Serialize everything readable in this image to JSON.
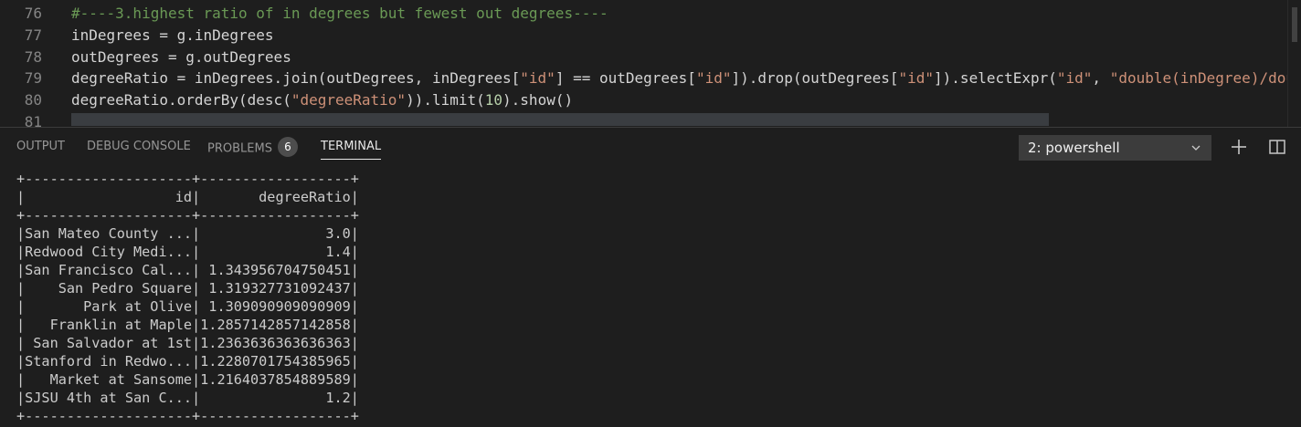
{
  "editor": {
    "lines": [
      {
        "num": "76",
        "segments": [
          {
            "t": "#----3.highest ratio of in degrees but fewest out degrees----",
            "c": "com"
          }
        ]
      },
      {
        "num": "77",
        "segments": [
          {
            "t": "inDegrees = g.inDegrees",
            "c": ""
          }
        ]
      },
      {
        "num": "78",
        "segments": [
          {
            "t": "outDegrees = g.outDegrees",
            "c": ""
          }
        ]
      },
      {
        "num": "79",
        "segments": [
          {
            "t": "degreeRatio = inDegrees.join(outDegrees, inDegrees[",
            "c": ""
          },
          {
            "t": "\"id\"",
            "c": "str"
          },
          {
            "t": "] == outDegrees[",
            "c": ""
          },
          {
            "t": "\"id\"",
            "c": "str"
          },
          {
            "t": "]).drop(outDegrees[",
            "c": ""
          },
          {
            "t": "\"id\"",
            "c": "str"
          },
          {
            "t": "]).selectExpr(",
            "c": ""
          },
          {
            "t": "\"id\"",
            "c": "str"
          },
          {
            "t": ", ",
            "c": ""
          },
          {
            "t": "\"double(inDegree)/dou",
            "c": "str"
          }
        ]
      },
      {
        "num": "80",
        "segments": [
          {
            "t": "degreeRatio.orderBy(desc(",
            "c": ""
          },
          {
            "t": "\"degreeRatio\"",
            "c": "str"
          },
          {
            "t": ")).limit(",
            "c": ""
          },
          {
            "t": "10",
            "c": "num"
          },
          {
            "t": ").show()",
            "c": ""
          }
        ]
      },
      {
        "num": "81",
        "segments": []
      }
    ]
  },
  "panel": {
    "tabs": [
      {
        "label": "OUTPUT",
        "name": "tab-output",
        "active": false
      },
      {
        "label": "DEBUG CONSOLE",
        "name": "tab-debug-console",
        "active": false
      },
      {
        "label": "PROBLEMS",
        "name": "tab-problems",
        "active": false,
        "badge": "6"
      },
      {
        "label": "TERMINAL",
        "name": "tab-terminal",
        "active": true
      }
    ],
    "terminal_select": "2: powershell",
    "icons": {
      "add": "plus-icon",
      "split": "split-terminal-icon",
      "dropdown": "chevron-down-icon"
    }
  },
  "terminal": {
    "lines": [
      "+--------------------+------------------+",
      "|                  id|       degreeRatio|",
      "+--------------------+------------------+",
      "|San Mateo County ...|               3.0|",
      "|Redwood City Medi...|               1.4|",
      "|San Francisco Cal...| 1.343956704750451|",
      "|    San Pedro Square| 1.319327731092437|",
      "|       Park at Olive| 1.309090909090909|",
      "|   Franklin at Maple|1.2857142857142858|",
      "| San Salvador at 1st|1.2363636363636363|",
      "|Stanford in Redwo...|1.2280701754385965|",
      "|   Market at Sansome|1.2164037854889589|",
      "|SJSU 4th at San C...|               1.2|",
      "+--------------------+------------------+"
    ]
  },
  "colors": {
    "background": "#1e1e1e",
    "comment": "#6a9955",
    "string": "#ce9178",
    "number": "#b5cea8",
    "line_number": "#858585"
  }
}
